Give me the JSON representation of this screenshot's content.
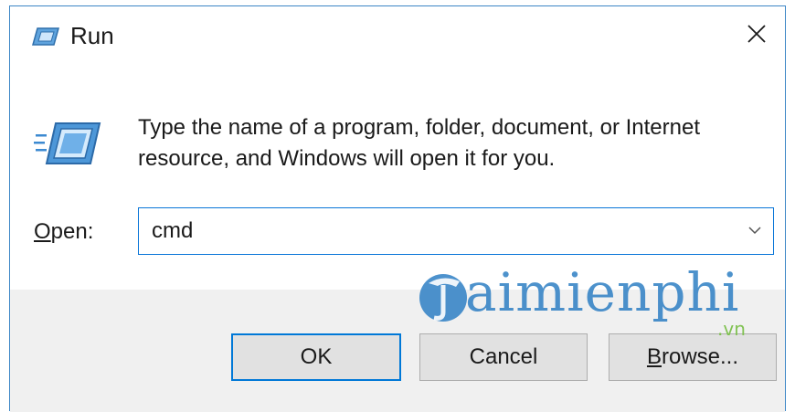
{
  "window": {
    "title": "Run"
  },
  "dialog": {
    "description": "Type the name of a program, folder, document, or Internet resource, and Windows will open it for you.",
    "open_label_mnemonic": "O",
    "open_label_rest": "pen:",
    "input_value": "cmd"
  },
  "buttons": {
    "ok_label": "OK",
    "cancel_label": "Cancel",
    "browse_mnemonic": "B",
    "browse_rest": "rowse..."
  },
  "watermark": {
    "text": "aimienphi",
    "suffix": ".vn"
  },
  "colors": {
    "accent": "#0078d7",
    "window_border": "#3d86c6",
    "footer_bg": "#f0f0f0",
    "button_bg": "#e1e1e1",
    "watermark_blue": "#2e7fc4",
    "watermark_green": "#7cc04b"
  },
  "icons": {
    "title": "run-app-icon",
    "close": "close-icon",
    "dialog": "run-app-icon",
    "dropdown": "chevron-down-icon"
  }
}
